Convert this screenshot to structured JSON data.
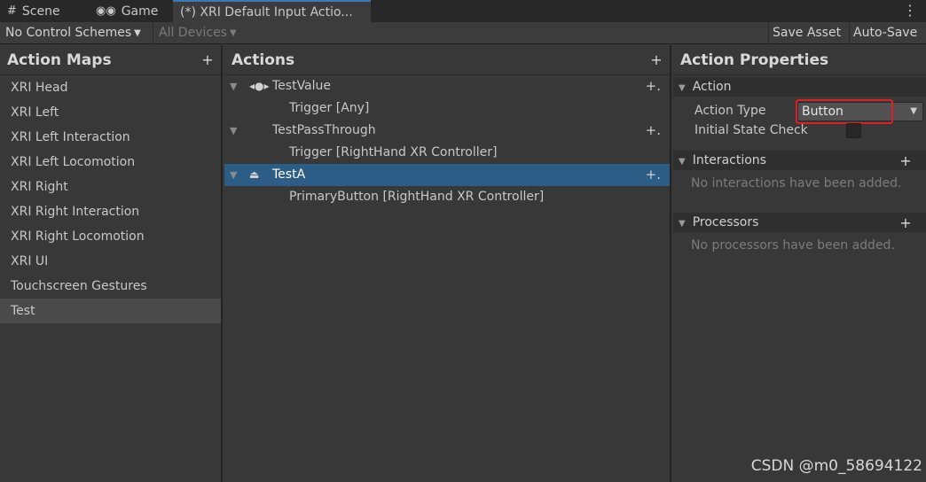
{
  "tabs": [
    {
      "glyph": "#",
      "label": "Scene"
    },
    {
      "glyph": "◉◉",
      "label": "Game"
    },
    {
      "label": "(*) XRI Default Input Actio..."
    }
  ],
  "tab_menu_glyph": "⋮",
  "toolbar": {
    "control_schemes": "No Control Schemes",
    "devices": "All Devices",
    "save_asset": "Save Asset",
    "auto_save": "Auto-Save"
  },
  "action_maps": {
    "title": "Action Maps",
    "items": [
      "XRI Head",
      "XRI Left",
      "XRI Left Interaction",
      "XRI Left Locomotion",
      "XRI Right",
      "XRI Right Interaction",
      "XRI Right Locomotion",
      "XRI UI",
      "Touchscreen Gestures",
      "Test"
    ],
    "selected": "Test"
  },
  "actions": {
    "title": "Actions",
    "rows": [
      {
        "kind": "action",
        "name": "TestValue",
        "icon": "value-icon",
        "selected": false
      },
      {
        "kind": "binding",
        "name": "Trigger [Any]"
      },
      {
        "kind": "action",
        "name": "TestPassThrough",
        "icon": "",
        "selected": false
      },
      {
        "kind": "binding",
        "name": "Trigger [RightHand XR Controller]"
      },
      {
        "kind": "action",
        "name": "TestA",
        "icon": "button-icon",
        "selected": true
      },
      {
        "kind": "binding",
        "name": "PrimaryButton [RightHand XR Controller]"
      }
    ]
  },
  "properties": {
    "title": "Action Properties",
    "action_section": "Action",
    "action_type_label": "Action Type",
    "action_type_value": "Button",
    "initial_state_label": "Initial State Check",
    "interactions_section": "Interactions",
    "interactions_empty": "No interactions have been added.",
    "processors_section": "Processors",
    "processors_empty": "No processors have been added."
  },
  "watermark": "CSDN @m0_58694122",
  "colors": {
    "selection_blue": "#2c5d87",
    "highlight_red": "#e02020",
    "tab_accent": "#3a79bb"
  }
}
